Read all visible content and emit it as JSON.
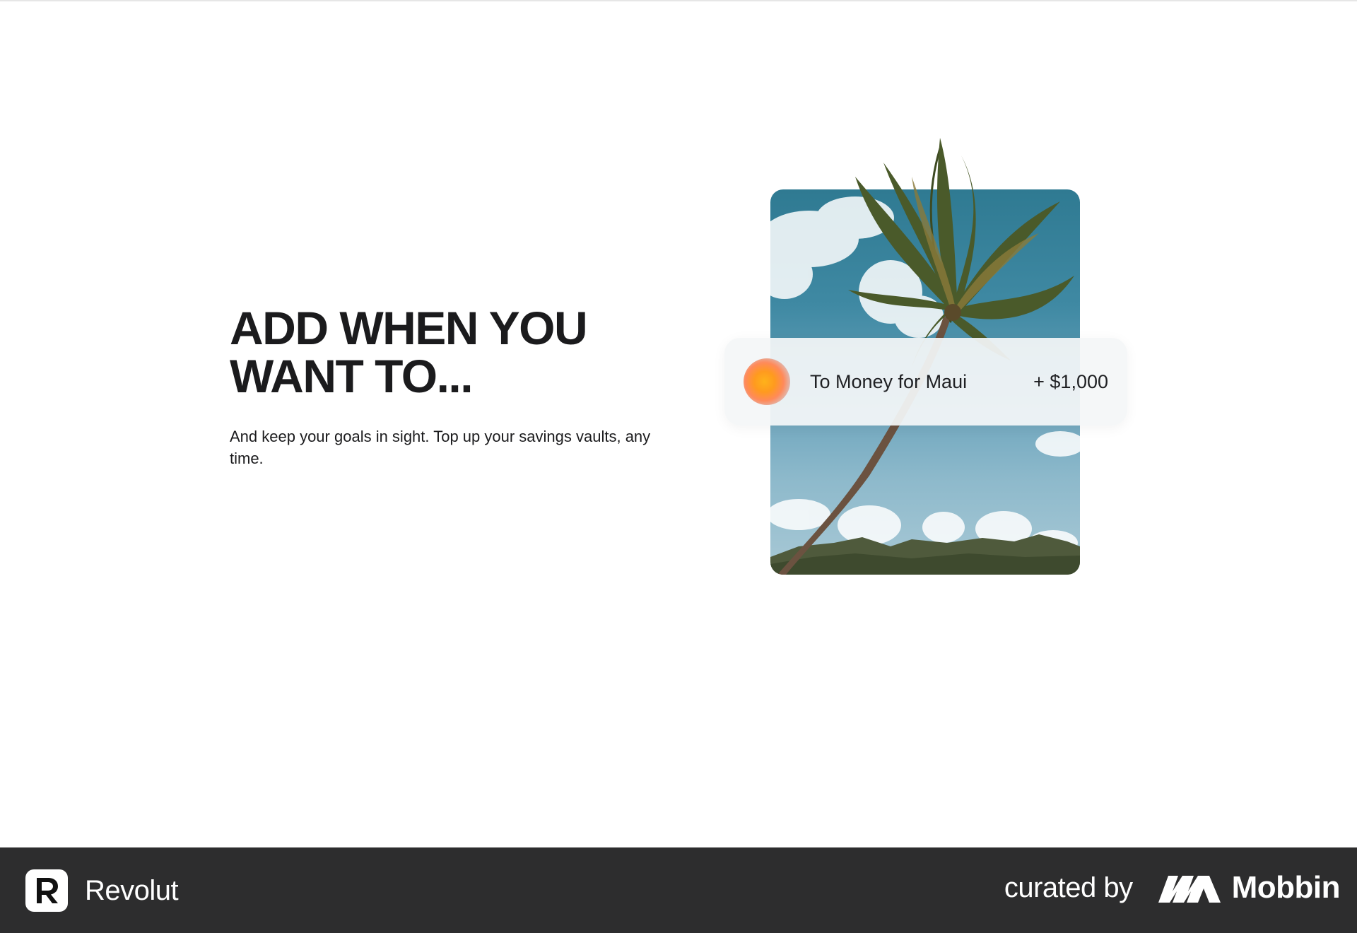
{
  "hero": {
    "title_line1": "ADD WHEN YOU",
    "title_line2": "WANT TO...",
    "subtitle": "And keep your goals in sight. Top up your savings vaults, any time."
  },
  "transaction": {
    "label": "To Money for Maui",
    "amount": "+ $1,000",
    "avatar_colors": [
      "#ffb21a",
      "#ff8a5a",
      "#cfd1d6"
    ]
  },
  "footer": {
    "app_name": "Revolut",
    "curated_by": "curated by",
    "curator_name": "Mobbin",
    "background": "#2d2d2e",
    "logo_letter": "R"
  },
  "illustration": {
    "subject": "palm-tree-photo"
  }
}
